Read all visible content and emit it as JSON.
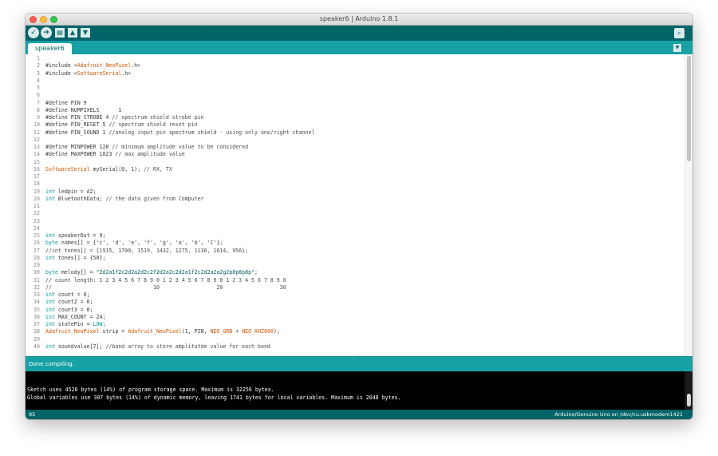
{
  "window": {
    "title": "speaker6 | Arduino 1.8.1"
  },
  "toolbar": {
    "verify_icon": "check-icon",
    "upload_icon": "arrow-right-icon",
    "new_icon": "new-document-icon",
    "open_icon": "arrow-up-icon",
    "save_icon": "arrow-down-icon",
    "serial_monitor_icon": "magnifier-icon"
  },
  "tabs": [
    {
      "label": "speaker6"
    }
  ],
  "colors": {
    "toolbar": "#006468",
    "tabbar": "#17a1a5",
    "keyword": "#00979c",
    "library_type": "#d35400",
    "comment": "#434f54",
    "string": "#005c5f"
  },
  "editor": {
    "lines": [
      {
        "n": "1",
        "t": []
      },
      {
        "n": "2",
        "t": [
          [
            "p",
            "#include <"
          ],
          [
            "lib",
            "Adafruit_NeoPixel"
          ],
          [
            "p",
            ".h>"
          ]
        ]
      },
      {
        "n": "3",
        "t": [
          [
            "p",
            "#include <"
          ],
          [
            "lib",
            "SoftwareSerial"
          ],
          [
            "p",
            ".h>"
          ]
        ]
      },
      {
        "n": "4",
        "t": []
      },
      {
        "n": "5",
        "t": []
      },
      {
        "n": "6",
        "t": []
      },
      {
        "n": "7",
        "t": [
          [
            "p",
            "#define PIN 9"
          ]
        ]
      },
      {
        "n": "8",
        "t": [
          [
            "p",
            "#define NUMPIXELS      1"
          ]
        ]
      },
      {
        "n": "9",
        "t": [
          [
            "p",
            "#define PIN_STROBE 4 "
          ],
          [
            "c",
            "// spectrum shield strobe pin"
          ]
        ]
      },
      {
        "n": "10",
        "t": [
          [
            "p",
            "#define PIN_RESET 5 "
          ],
          [
            "c",
            "// spectrum shield reset pin"
          ]
        ]
      },
      {
        "n": "11",
        "t": [
          [
            "p",
            "#define PIN_SOUND 1 "
          ],
          [
            "c",
            "//analog input pin spectrum shield - using only one/right channel"
          ]
        ]
      },
      {
        "n": "12",
        "t": []
      },
      {
        "n": "13",
        "t": [
          [
            "p",
            "#define MINPOWER 128 "
          ],
          [
            "c",
            "// minimum amplitude value to be considered"
          ]
        ]
      },
      {
        "n": "14",
        "t": [
          [
            "p",
            "#define MAXPOWER 1023 "
          ],
          [
            "c",
            "// max amplitude value"
          ]
        ]
      },
      {
        "n": "15",
        "t": []
      },
      {
        "n": "16",
        "t": [
          [
            "lib",
            "SoftwareSerial"
          ],
          [
            "p",
            " mySerial(0, 1); "
          ],
          [
            "c",
            "// RX, TX"
          ]
        ]
      },
      {
        "n": "17",
        "t": []
      },
      {
        "n": "18",
        "t": []
      },
      {
        "n": "19",
        "t": [
          [
            "kw",
            "int"
          ],
          [
            "p",
            " ledpin = A2;"
          ]
        ]
      },
      {
        "n": "20",
        "t": [
          [
            "kw",
            "int"
          ],
          [
            "p",
            " BluetoothData; "
          ],
          [
            "c",
            "// the data given from Computer"
          ]
        ]
      },
      {
        "n": "21",
        "t": []
      },
      {
        "n": "22",
        "t": []
      },
      {
        "n": "23",
        "t": []
      },
      {
        "n": "24",
        "t": []
      },
      {
        "n": "25",
        "t": [
          [
            "kw",
            "int"
          ],
          [
            "p",
            " speakerOut = 9;"
          ]
        ]
      },
      {
        "n": "26",
        "t": [
          [
            "kw",
            "byte"
          ],
          [
            "p",
            " names[] = {'c', 'd', 'e', 'f', 'g', 'a', 'b', 'C'};"
          ]
        ]
      },
      {
        "n": "27",
        "t": [
          [
            "c",
            "//int tones[] = {1915, 1700, 1519, 1432, 1275, 1136, 1014, 956};"
          ]
        ]
      },
      {
        "n": "28",
        "t": [
          [
            "kw",
            "int"
          ],
          [
            "p",
            " tones[] = {50};"
          ]
        ]
      },
      {
        "n": "29",
        "t": []
      },
      {
        "n": "30",
        "t": [
          [
            "kw",
            "byte"
          ],
          [
            "p",
            " melody[] = "
          ],
          [
            "s",
            "\"2d2a1f2c2d2a2d2c2f2d2a2c2d2a1f2c2d2a2a2g2p8p8p8p\""
          ],
          [
            "p",
            ";"
          ]
        ]
      },
      {
        "n": "31",
        "t": [
          [
            "c",
            "// count length: 1 2 3 4 5 6 7 8 9 0 1 2 3 4 5 6 7 8 9 0 1 2 3 4 5 6 7 8 9 0"
          ]
        ]
      },
      {
        "n": "32",
        "t": [
          [
            "c",
            "//                                10                  20                  30"
          ]
        ]
      },
      {
        "n": "33",
        "t": [
          [
            "kw",
            "int"
          ],
          [
            "p",
            " count = 0;"
          ]
        ]
      },
      {
        "n": "34",
        "t": [
          [
            "kw",
            "int"
          ],
          [
            "p",
            " count2 = 0;"
          ]
        ]
      },
      {
        "n": "35",
        "t": [
          [
            "kw",
            "int"
          ],
          [
            "p",
            " count3 = 0;"
          ]
        ]
      },
      {
        "n": "36",
        "t": [
          [
            "kw",
            "int"
          ],
          [
            "p",
            " MAX_COUNT = 24;"
          ]
        ]
      },
      {
        "n": "37",
        "t": [
          [
            "kw",
            "int"
          ],
          [
            "p",
            " statePin = "
          ],
          [
            "kw",
            "LOW"
          ],
          [
            "p",
            ";"
          ]
        ]
      },
      {
        "n": "38",
        "t": [
          [
            "lib",
            "Adafruit_NeoPixel"
          ],
          [
            "p",
            " strip = "
          ],
          [
            "lib",
            "Adafruit_NeoPixel"
          ],
          [
            "p",
            "(1, PIN, "
          ],
          [
            "lib",
            "NEO_GRB"
          ],
          [
            "p",
            " + "
          ],
          [
            "lib",
            "NEO_KHZ800"
          ],
          [
            "p",
            ");"
          ]
        ]
      },
      {
        "n": "39",
        "t": []
      },
      {
        "n": "40",
        "t": [
          [
            "kw",
            "int"
          ],
          [
            "p",
            " soundvalue[7]; "
          ],
          [
            "c",
            "//band array to store amplitutde value for each band"
          ]
        ]
      }
    ]
  },
  "status": {
    "message": "Done compiling."
  },
  "console": {
    "lines": [
      "Sketch uses 4520 bytes (14%) of program storage space. Maximum is 32256 bytes.",
      "Global variables use 307 bytes (14%) of dynamic memory, leaving 1741 bytes for local variables. Maximum is 2048 bytes."
    ]
  },
  "footer": {
    "line_number": "95",
    "board": "Arduino/Genuino Uno on /dev/cu.usbmodem1421"
  }
}
